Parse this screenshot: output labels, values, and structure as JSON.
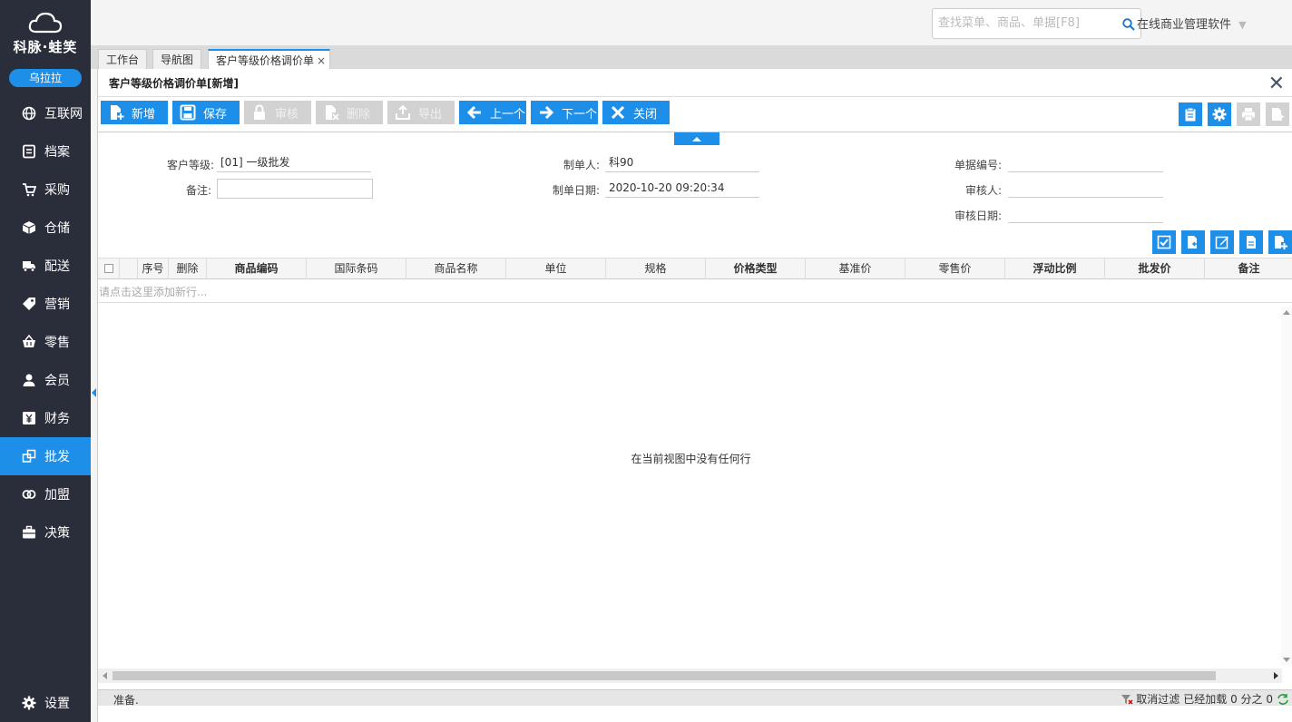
{
  "sidebar": {
    "logo_text": "科脉·蛙笑",
    "user": "乌拉拉",
    "items": [
      {
        "label": "互联网",
        "icon": "globe-icon"
      },
      {
        "label": "档案",
        "icon": "archive-icon"
      },
      {
        "label": "采购",
        "icon": "cart-icon"
      },
      {
        "label": "仓储",
        "icon": "box-icon"
      },
      {
        "label": "配送",
        "icon": "truck-icon"
      },
      {
        "label": "营销",
        "icon": "tag-icon"
      },
      {
        "label": "零售",
        "icon": "basket-icon"
      },
      {
        "label": "会员",
        "icon": "user-icon"
      },
      {
        "label": "财务",
        "icon": "yen-icon"
      },
      {
        "label": "批发",
        "icon": "wholesale-icon"
      },
      {
        "label": "加盟",
        "icon": "rings-icon"
      },
      {
        "label": "决策",
        "icon": "briefcase-icon"
      }
    ],
    "active_item": "批发",
    "settings_label": "设置"
  },
  "header": {
    "search_placeholder": "查找菜单、商品、单据[F8]",
    "company": "在线商业管理软件"
  },
  "tabs": [
    {
      "label": "工作台"
    },
    {
      "label": "导航图"
    },
    {
      "label": "客户等级价格调价单",
      "active": true
    }
  ],
  "panel": {
    "title": "客户等级价格调价单[新增]"
  },
  "toolbar": {
    "new": "新增",
    "save": "保存",
    "audit": "审核",
    "delete": "删除",
    "export": "导出",
    "prev": "上一个",
    "next": "下一个",
    "close": "关闭"
  },
  "form": {
    "customer_level_label": "客户等级:",
    "customer_level_value": "[01] 一级批发",
    "remark_label": "备注:",
    "remark_value": "",
    "creator_label": "制单人:",
    "creator_value": "科90",
    "create_date_label": "制单日期:",
    "create_date_value": "2020-10-20 09:20:34",
    "doc_no_label": "单据编号:",
    "doc_no_value": "",
    "auditor_label": "审核人:",
    "auditor_value": "",
    "audit_date_label": "审核日期:",
    "audit_date_value": ""
  },
  "grid": {
    "columns": [
      "序号",
      "删除",
      "商品编码",
      "国际条码",
      "商品名称",
      "单位",
      "规格",
      "价格类型",
      "基准价",
      "零售价",
      "浮动比例",
      "批发价",
      "备注"
    ],
    "add_row_hint": "请点击这里添加新行...",
    "empty_message": "在当前视图中没有任何行"
  },
  "status": {
    "text": "准备.",
    "clear_filter": "取消过滤",
    "loaded": "已经加载 0 分之 0"
  },
  "colors": {
    "sidebar_bg": "#2a2d3a",
    "accent": "#1e8fe8",
    "disabled": "#d2d2d2"
  }
}
